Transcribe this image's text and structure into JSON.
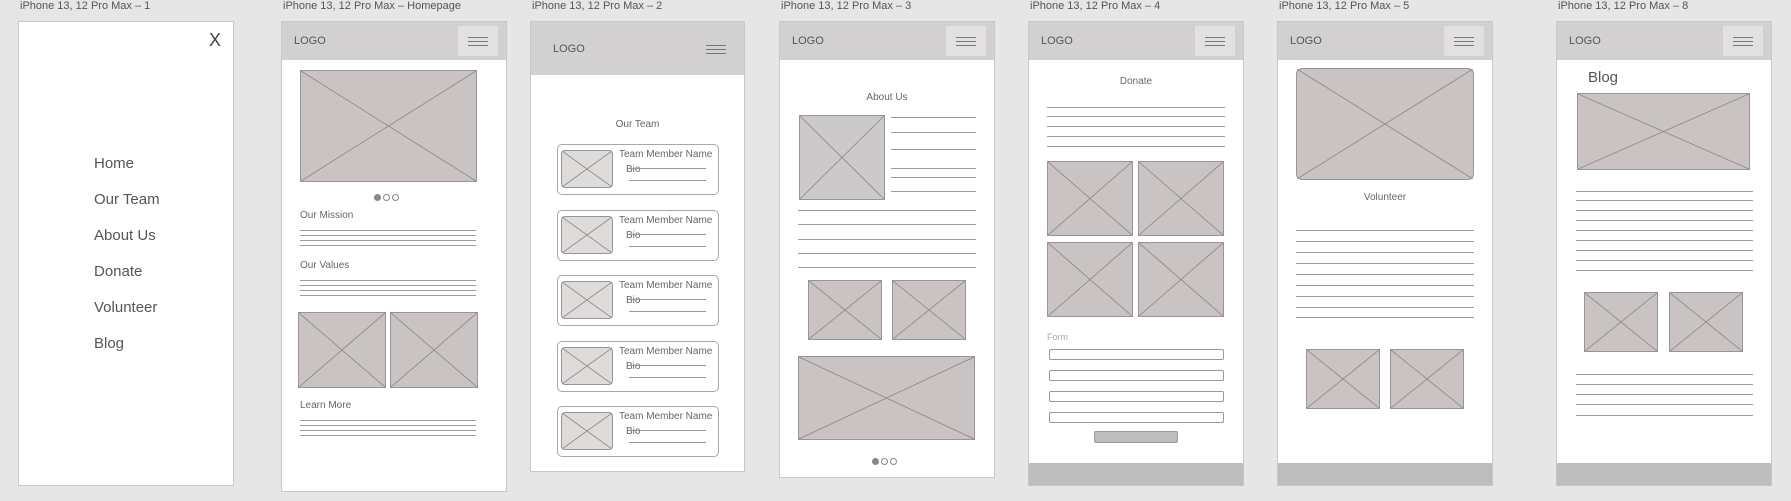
{
  "frames": [
    {
      "title": "iPhone 13, 12 Pro Max – 1"
    },
    {
      "title": "iPhone 13, 12 Pro Max – Homepage"
    },
    {
      "title": "iPhone 13, 12 Pro Max – 2"
    },
    {
      "title": "iPhone 13, 12 Pro Max – 3"
    },
    {
      "title": "iPhone 13, 12 Pro Max – 4"
    },
    {
      "title": "iPhone 13, 12 Pro Max – 5"
    },
    {
      "title": "iPhone 13, 12 Pro Max – 8"
    }
  ],
  "logo": "LOGO",
  "menu": {
    "close": "X",
    "items": [
      "Home",
      "Our Team",
      "About Us",
      "Donate",
      "Volunteer",
      "Blog"
    ]
  },
  "homepage": {
    "mission": "Our Mission",
    "values": "Our Values",
    "learn_more": "Learn More"
  },
  "team": {
    "heading": "Our Team",
    "member_name": "Team Member Name",
    "bio": "Bio"
  },
  "about": {
    "heading": "About Us"
  },
  "donate": {
    "heading": "Donate",
    "form_label": "Form"
  },
  "volunteer": {
    "heading": "Volunteer"
  },
  "blog": {
    "heading": "Blog"
  },
  "colors": {
    "background": "#e6e6e6",
    "header": "#d2d0d0",
    "placeholder": "#c9c3c3",
    "footer": "#bdbdbd"
  }
}
